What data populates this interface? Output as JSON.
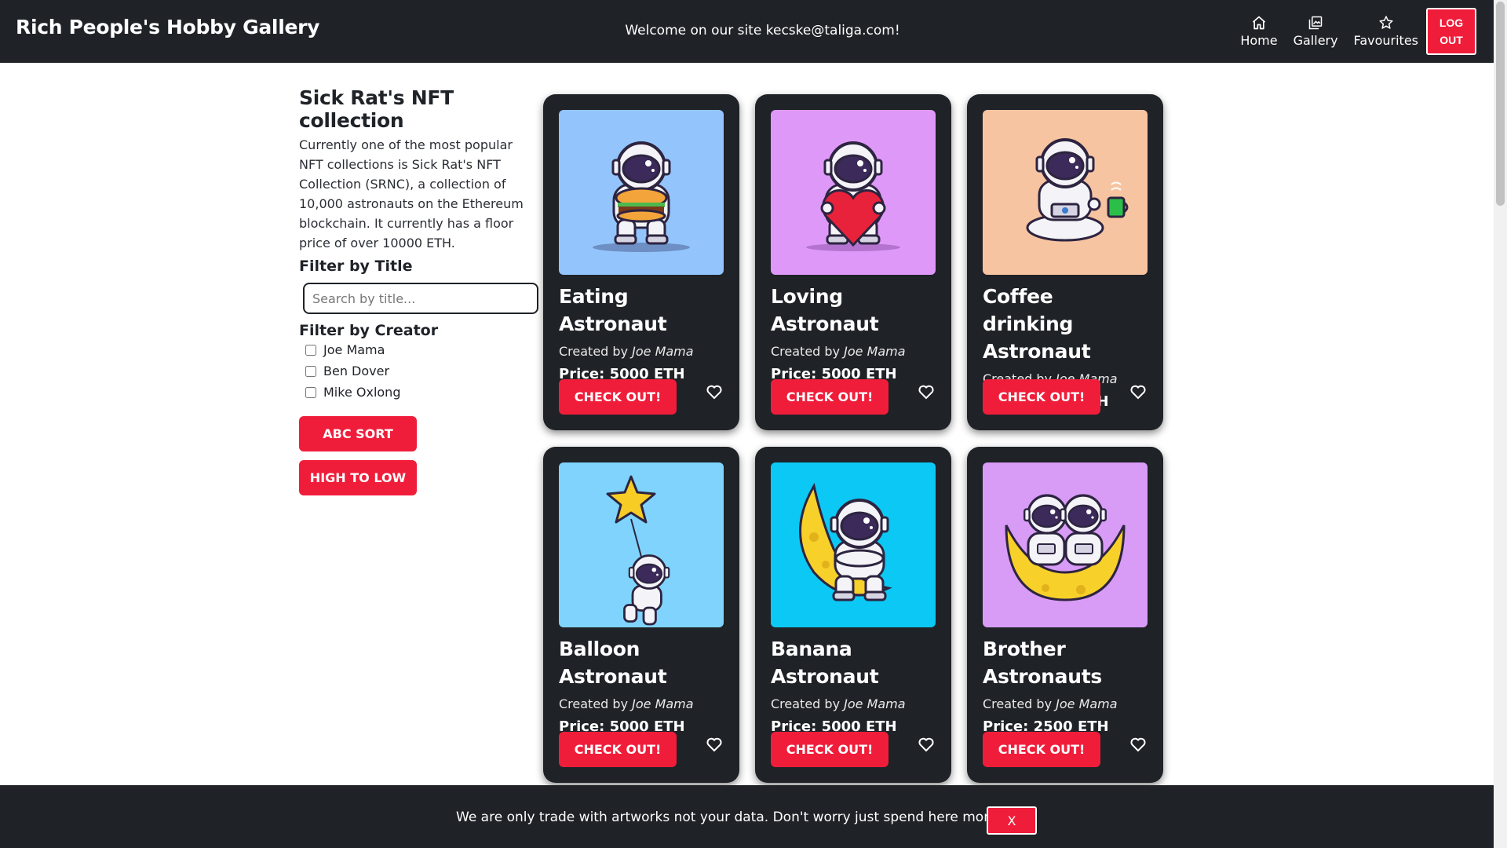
{
  "header": {
    "brand": "Rich People's Hobby Gallery",
    "welcome": "Welcome on our site kecske@taliga.com!",
    "nav": [
      {
        "label": "Home",
        "icon": "home-icon"
      },
      {
        "label": "Gallery",
        "icon": "gallery-icon"
      },
      {
        "label": "Favourites",
        "icon": "star-icon"
      }
    ],
    "logout_label": "LOG OUT"
  },
  "sidebar": {
    "title": "Sick Rat's NFT collection",
    "description": "Currently one of the most popular NFT collections is Sick Rat's NFT Collection (SRNC), a collection of 10,000 astronauts on the Ethereum blockchain. It currently has a floor price of over 10000 ETH.",
    "filter_title_label": "Filter by Title",
    "search_placeholder": "Search by title...",
    "filter_creator_label": "Filter by Creator",
    "creators": [
      "Joe Mama",
      "Ben Dover",
      "Mike Oxlong"
    ],
    "sort_abc_label": "ABC SORT",
    "sort_price_label": "HIGH TO LOW"
  },
  "cards": [
    {
      "title": "Eating Astronaut",
      "created_by": "Created by",
      "creator": "Joe Mama",
      "price": "Price: 5000 ETH",
      "checkout": "CHECK OUT!",
      "bg": "#93c4fb",
      "art": "burger"
    },
    {
      "title": "Loving Astronaut",
      "created_by": "Created by",
      "creator": "Joe Mama",
      "price": "Price: 5000 ETH",
      "checkout": "CHECK OUT!",
      "bg": "#de98f8",
      "art": "heart"
    },
    {
      "title": "Coffee drinking Astronaut",
      "created_by": "Created by",
      "creator": "Joe Mama",
      "price": "Price: 5000 ETH",
      "checkout": "CHECK OUT!",
      "bg": "#f7c4a2",
      "art": "coffee"
    },
    {
      "title": "Balloon Astronaut",
      "created_by": "Created by",
      "creator": "Joe Mama",
      "price": "Price: 5000 ETH",
      "checkout": "CHECK OUT!",
      "bg": "#7fd3fd",
      "art": "balloon"
    },
    {
      "title": "Banana Astronaut",
      "created_by": "Created by",
      "creator": "Joe Mama",
      "price": "Price: 5000 ETH",
      "checkout": "CHECK OUT!",
      "bg": "#0cc8f5",
      "art": "banana"
    },
    {
      "title": "Brother Astronauts",
      "created_by": "Created by",
      "creator": "Joe Mama",
      "price": "Price: 2500 ETH",
      "checkout": "CHECK OUT!",
      "bg": "#d89bf6",
      "art": "brothers"
    }
  ],
  "cookie": {
    "text": "We are only trade with artworks not your data. Don't worry just spend here money!",
    "close_label": "X"
  },
  "colors": {
    "accent": "#f01d3a",
    "dark": "#1f2227"
  }
}
